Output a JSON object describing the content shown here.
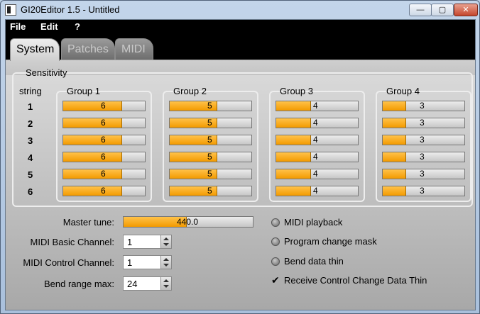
{
  "window": {
    "title": "GI20Editor 1.5 - Untitled",
    "min_glyph": "—",
    "max_glyph": "▢",
    "close_glyph": "✕"
  },
  "menu": [
    "File",
    "Edit",
    "?"
  ],
  "tabs": [
    {
      "label": "System",
      "active": true
    },
    {
      "label": "Patches",
      "active": false
    },
    {
      "label": "MIDI",
      "active": false
    }
  ],
  "sensitivity": {
    "title": "Sensitivity",
    "string_header": "string",
    "strings": [
      "1",
      "2",
      "3",
      "4",
      "5",
      "6"
    ],
    "groups": [
      {
        "label": "Group 1",
        "values": [
          "6",
          "6",
          "6",
          "6",
          "6",
          "6"
        ],
        "levels": [
          0.72,
          0.72,
          0.72,
          0.72,
          0.72,
          0.72
        ]
      },
      {
        "label": "Group 2",
        "values": [
          "5",
          "5",
          "5",
          "5",
          "5",
          "5"
        ],
        "levels": [
          0.58,
          0.58,
          0.58,
          0.58,
          0.58,
          0.58
        ]
      },
      {
        "label": "Group 3",
        "values": [
          "4",
          "4",
          "4",
          "4",
          "4",
          "4"
        ],
        "levels": [
          0.43,
          0.43,
          0.43,
          0.43,
          0.43,
          0.43
        ]
      },
      {
        "label": "Group 4",
        "values": [
          "3",
          "3",
          "3",
          "3",
          "3",
          "3"
        ],
        "levels": [
          0.29,
          0.29,
          0.29,
          0.29,
          0.29,
          0.29
        ]
      }
    ]
  },
  "settings": {
    "master_tune_label": "Master tune:",
    "master_tune_value": "440.0",
    "master_tune_level": 0.49,
    "basic_channel_label": "MIDI Basic Channel:",
    "basic_channel_value": "1",
    "control_channel_label": "MIDI Control Channel:",
    "control_channel_value": "1",
    "bend_range_label": "Bend range max:",
    "bend_range_value": "24"
  },
  "options": [
    {
      "label": "MIDI playback",
      "checked": false
    },
    {
      "label": "Program change mask",
      "checked": false
    },
    {
      "label": "Bend data thin",
      "checked": false
    },
    {
      "label": "Receive Control Change Data Thin",
      "checked": true
    }
  ],
  "colors": {
    "bar_fill": "#f5a623",
    "tab_bar": "#000000"
  }
}
